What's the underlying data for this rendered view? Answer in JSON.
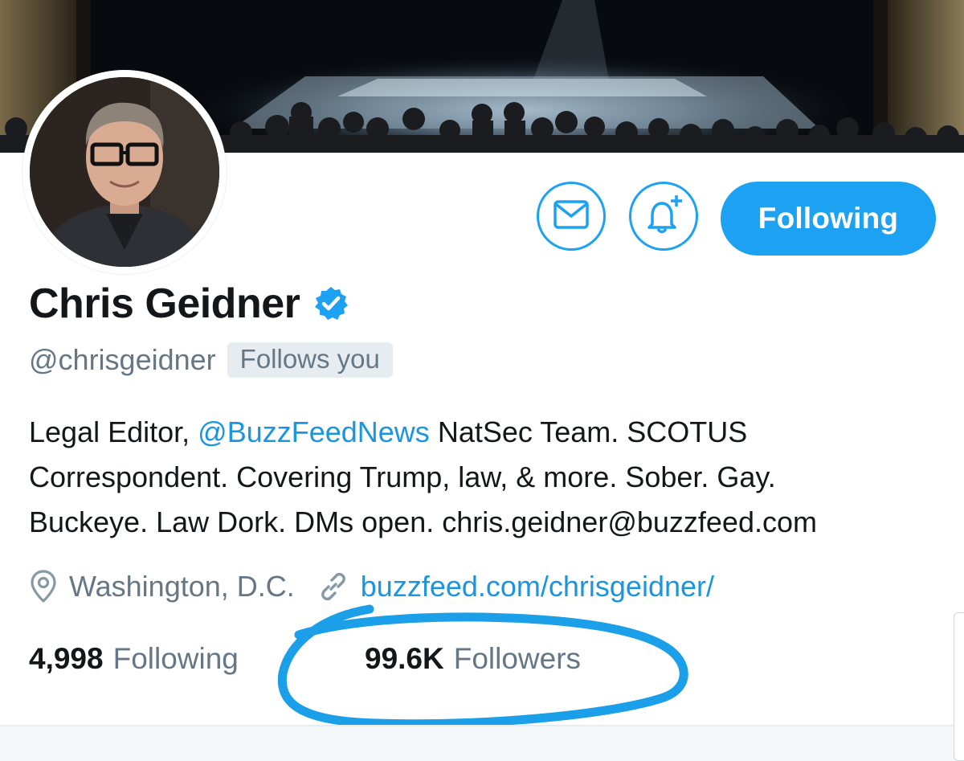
{
  "profile": {
    "display_name": "Chris Geidner",
    "handle": "@chrisgeidner",
    "follows_you_badge": "Follows you",
    "verified": true
  },
  "actions": {
    "message_icon": "envelope-icon",
    "notify_icon": "bell-plus-icon",
    "follow_label": "Following"
  },
  "bio": {
    "line1_prefix": "Legal Editor, ",
    "line1_mention": "@BuzzFeedNews",
    "line1_suffix": " NatSec Team. SCOTUS",
    "line2": "Correspondent. Covering Trump, law, & more. Sober. Gay.",
    "line3": "Buckeye. Law Dork. DMs open. chris.geidner@buzzfeed.com"
  },
  "meta": {
    "location": "Washington, D.C.",
    "website": "buzzfeed.com/chrisgeidner/"
  },
  "stats": {
    "following_count": "4,998",
    "following_label": "Following",
    "followers_count": "99.6K",
    "followers_label": "Followers"
  },
  "colors": {
    "accent": "#1da1f2",
    "link": "#1b95e0",
    "secondary_text": "#657786",
    "annotation_stroke": "#1a9fe8"
  }
}
